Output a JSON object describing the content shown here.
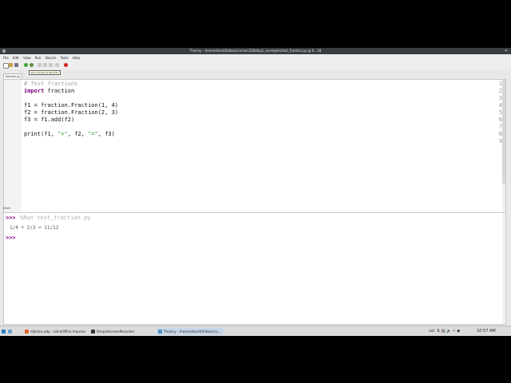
{
  "window": {
    "title": "Thonny - /home/david/Videos/comsci328/day2_examples/test_fraction.py @ 6 : 28"
  },
  "menu": [
    "File",
    "Edit",
    "View",
    "Run",
    "Device",
    "Tools",
    "Help"
  ],
  "toolbar": {
    "tooltip": "Run current script (F5)",
    "icons": [
      "new-file-icon",
      "open-icon",
      "save-icon",
      "run-icon",
      "debug-icon",
      "step-over-icon",
      "step-into-icon",
      "step-out-icon",
      "resume-icon",
      "stop-icon"
    ]
  },
  "editor": {
    "tab_label": "fraction.py",
    "lines": [
      {
        "n": "1",
        "text": "# Test fractions"
      },
      {
        "n": "2",
        "text": "import fraction"
      },
      {
        "n": "3",
        "text": ""
      },
      {
        "n": "4",
        "text": "f1 = fraction.Fraction(1, 4)"
      },
      {
        "n": "5",
        "text": "f2 = fraction.Fraction(2, 3)"
      },
      {
        "n": "6",
        "text": "f3 = f1.add(f2)"
      },
      {
        "n": "7",
        "text": ""
      },
      {
        "n": "8",
        "text": "print(f1, \"+\", f2, \"=\", f3)"
      },
      {
        "n": "9",
        "text": ""
      }
    ]
  },
  "shell": {
    "tab_label": "Shell",
    "prompt": ">>>",
    "run_command": "%Run test_fraction.py",
    "output": "1/4 + 2/3 = 11/12"
  },
  "taskbar": {
    "tasks": [
      {
        "label": "dijkstra.odp - LibreOffice Impress",
        "color": "#e06030"
      },
      {
        "label": "SimpleScreenRecorder",
        "color": "#333333"
      },
      {
        "label": "Thonny - /home/david/Videos/co...",
        "color": "#4a90c0"
      }
    ],
    "keyboard": "usi",
    "clock": "10:57 AM"
  }
}
